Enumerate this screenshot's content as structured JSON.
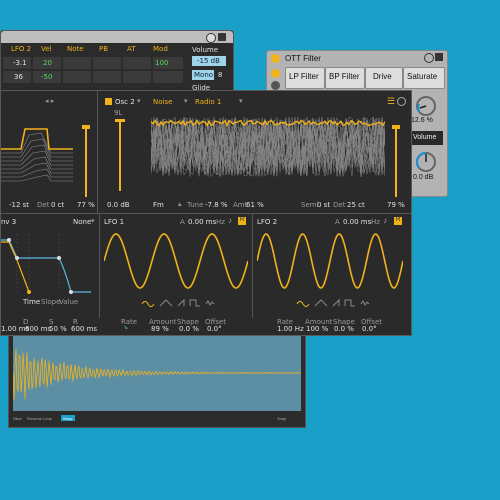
{
  "mod_panel": {
    "headers": [
      "LFO 2",
      "Vel",
      "Note",
      "PB",
      "AT",
      "Mod"
    ],
    "row1": [
      "-3.1",
      "20",
      "",
      "",
      "",
      "100"
    ],
    "row2": [
      "36",
      "-50",
      "",
      "",
      "",
      ""
    ],
    "volume_label": "Volume",
    "volume_value": "-15 dB",
    "mono_label": "Mono",
    "voices_value": "8",
    "glide_label": "Glide"
  },
  "ott": {
    "title": "OTT Filter",
    "tabs": [
      "LP Filter",
      "BP Filter",
      "Drive",
      "Saturate"
    ],
    "knob1_value": "12.6 %",
    "volume_label": "Volume",
    "knob2_value": "0.0 dB"
  },
  "osc": {
    "osc_label": "Osc 2",
    "noise_label": "Noise",
    "radio_label": "Radio 1",
    "level_top": "9L",
    "left_db": "0.0 dB",
    "fm_label": "Fm",
    "tune_label": "Tune",
    "tune_value": "-7.8 %",
    "amt_label": "Amt",
    "amt_value": "61 %",
    "semi_label": "Semi",
    "semi_value": "0 st",
    "det_label": "Det",
    "det_value": "25 ct",
    "right_pct": "79 %",
    "left_tune": "-12 st",
    "left_det_label": "Det",
    "left_det_value": "0 ct",
    "left_pct": "77 %"
  },
  "env": {
    "title": "nv 3",
    "mode": "None",
    "tabs": [
      "Time",
      "Slope",
      "Value"
    ],
    "param_labels": [
      "D",
      "S",
      "R"
    ],
    "param_values": [
      "1.00 ms",
      "600 ms",
      "50 %",
      "600 ms"
    ]
  },
  "lfo1": {
    "title": "LFO 1",
    "a_label": "A",
    "a_value": "0.00 ms",
    "hz_label": "Hz",
    "r_badge": "R",
    "param_labels": [
      "Rate",
      "Amount",
      "Shape",
      "Offset"
    ],
    "param_values": [
      "",
      "89 %",
      "0.0 %",
      "0.0°"
    ]
  },
  "lfo2": {
    "title": "LFO 2",
    "a_label": "A",
    "a_value": "0.00 ms",
    "hz_label": "Hz",
    "r_badge": "R",
    "param_labels": [
      "Rate",
      "Amount",
      "Shape",
      "Offset"
    ],
    "param_values": [
      "1.00 Hz",
      "100 %",
      "0.0 %",
      "0.0°"
    ]
  },
  "sampler_footer": {
    "items": [
      "Slice",
      "Reverse",
      "Loop",
      "Warp",
      "Snap"
    ]
  },
  "colors": {
    "accent": "#f2b21b",
    "background": "#1aa0c8",
    "panel": "#2a2a2a",
    "panel_light": "#b5b5b5"
  }
}
